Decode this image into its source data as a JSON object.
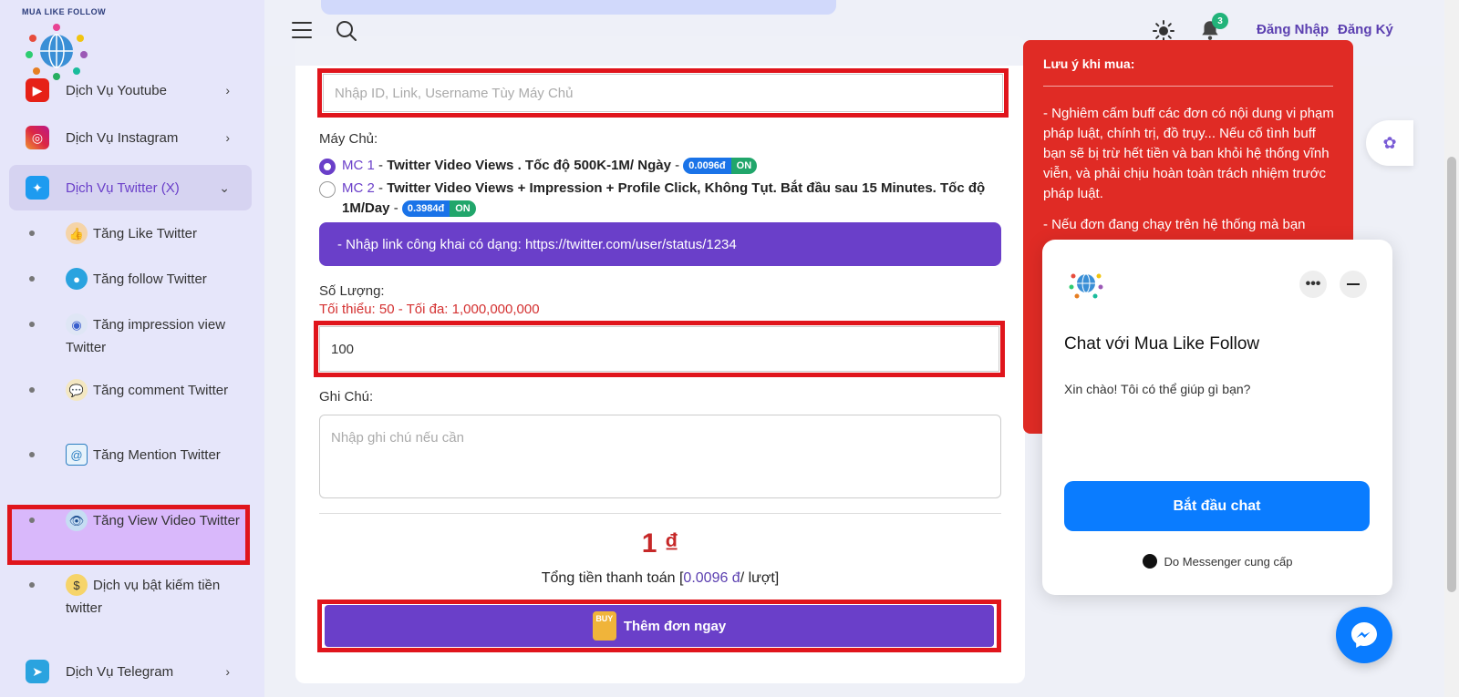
{
  "brand": {
    "logo_text": "MUA LIKE FOLLOW"
  },
  "sidebar": {
    "items": [
      {
        "label": "Dịch Vụ Youtube",
        "icon": "youtube-icon",
        "color": "#e62117"
      },
      {
        "label": "Dịch Vụ Instagram",
        "icon": "instagram-icon",
        "color": "#d6249f"
      },
      {
        "label": "Dịch Vụ Twitter (X)",
        "icon": "twitter-icon",
        "color": "#1d9bf0"
      },
      {
        "label": "Dịch Vụ Telegram",
        "icon": "telegram-icon",
        "color": "#2aa3df"
      }
    ],
    "sub_items": [
      {
        "label": "Tăng Like Twitter",
        "icon": "like-hand-icon"
      },
      {
        "label": "Tăng follow Twitter",
        "icon": "user-follow-icon"
      },
      {
        "label": "Tăng impression view Twitter",
        "icon": "impression-eye-icon"
      },
      {
        "label": "Tăng comment Twitter",
        "icon": "comment-bubble-icon"
      },
      {
        "label": "Tăng Mention Twitter",
        "icon": "mention-at-icon"
      },
      {
        "label": "Tăng View Video Twitter",
        "icon": "eye-icon"
      },
      {
        "label": "Dịch vụ bật kiếm tiền twitter",
        "icon": "money-icon"
      }
    ]
  },
  "header": {
    "login": "Đăng Nhập",
    "signup": "Đăng Ký",
    "notification_count": "3"
  },
  "form": {
    "link_placeholder": "Nhập ID, Link, Username Tùy Máy Chủ",
    "server_label": "Máy Chủ:",
    "servers": [
      {
        "code": "MC 1",
        "dash": " - ",
        "name": "Twitter Video Views . Tốc độ 500K-1M/ Ngày",
        "price": "0.0096đ",
        "status": "ON",
        "selected": true
      },
      {
        "code": "MC 2",
        "dash": " - ",
        "name_line1": "Twitter Video Views + Impression + Profile Click, Không Tụt. Bắt đầu sau 15 Minutes. Tốc độ",
        "name_line2": "1M/Day",
        "price": "0.3984đ",
        "status": "ON",
        "selected": false
      }
    ],
    "notice": "- Nhập link công khai có dạng: https://twitter.com/user/status/1234",
    "quantity_label": "Số Lượng:",
    "quantity_range": "Tối thiểu: 50 - Tối đa: 1,000,000,000",
    "quantity_value": "100",
    "note_label": "Ghi Chú:",
    "note_placeholder": "Nhập ghi chú nếu cần",
    "total_price": "1 ₫",
    "total_label_prefix": "Tổng tiền thanh toán [",
    "total_rate": "0.0096 đ",
    "total_label_suffix": "/ lượt]",
    "submit_label": "Thêm đơn ngay",
    "buy_badge": "BUY"
  },
  "warning_panel": {
    "title": "Lưu ý khi mua:",
    "text1": "- Nghiêm cấm buff các đơn có nội dung vi phạm pháp luật, chính trị, đồ trụy... Nếu cố tình buff bạn sẽ bị trừ hết tiền và ban khỏi hệ thống vĩnh viễn, và phải chịu hoàn toàn trách nhiệm trước pháp luật.",
    "text2": "- Nếu đơn đang chạy trên hệ thống mà bạn"
  },
  "chat": {
    "title": "Chat với Mua Like Follow",
    "greeting": "Xin chào! Tôi có thể giúp gì bạn?",
    "start_button": "Bắt đầu chat",
    "powered_by": "Do Messenger cung cấp",
    "more": "•••"
  },
  "colors": {
    "accent": "#6a3fc9",
    "danger": "#e02b25",
    "messenger": "#0a7cff"
  }
}
